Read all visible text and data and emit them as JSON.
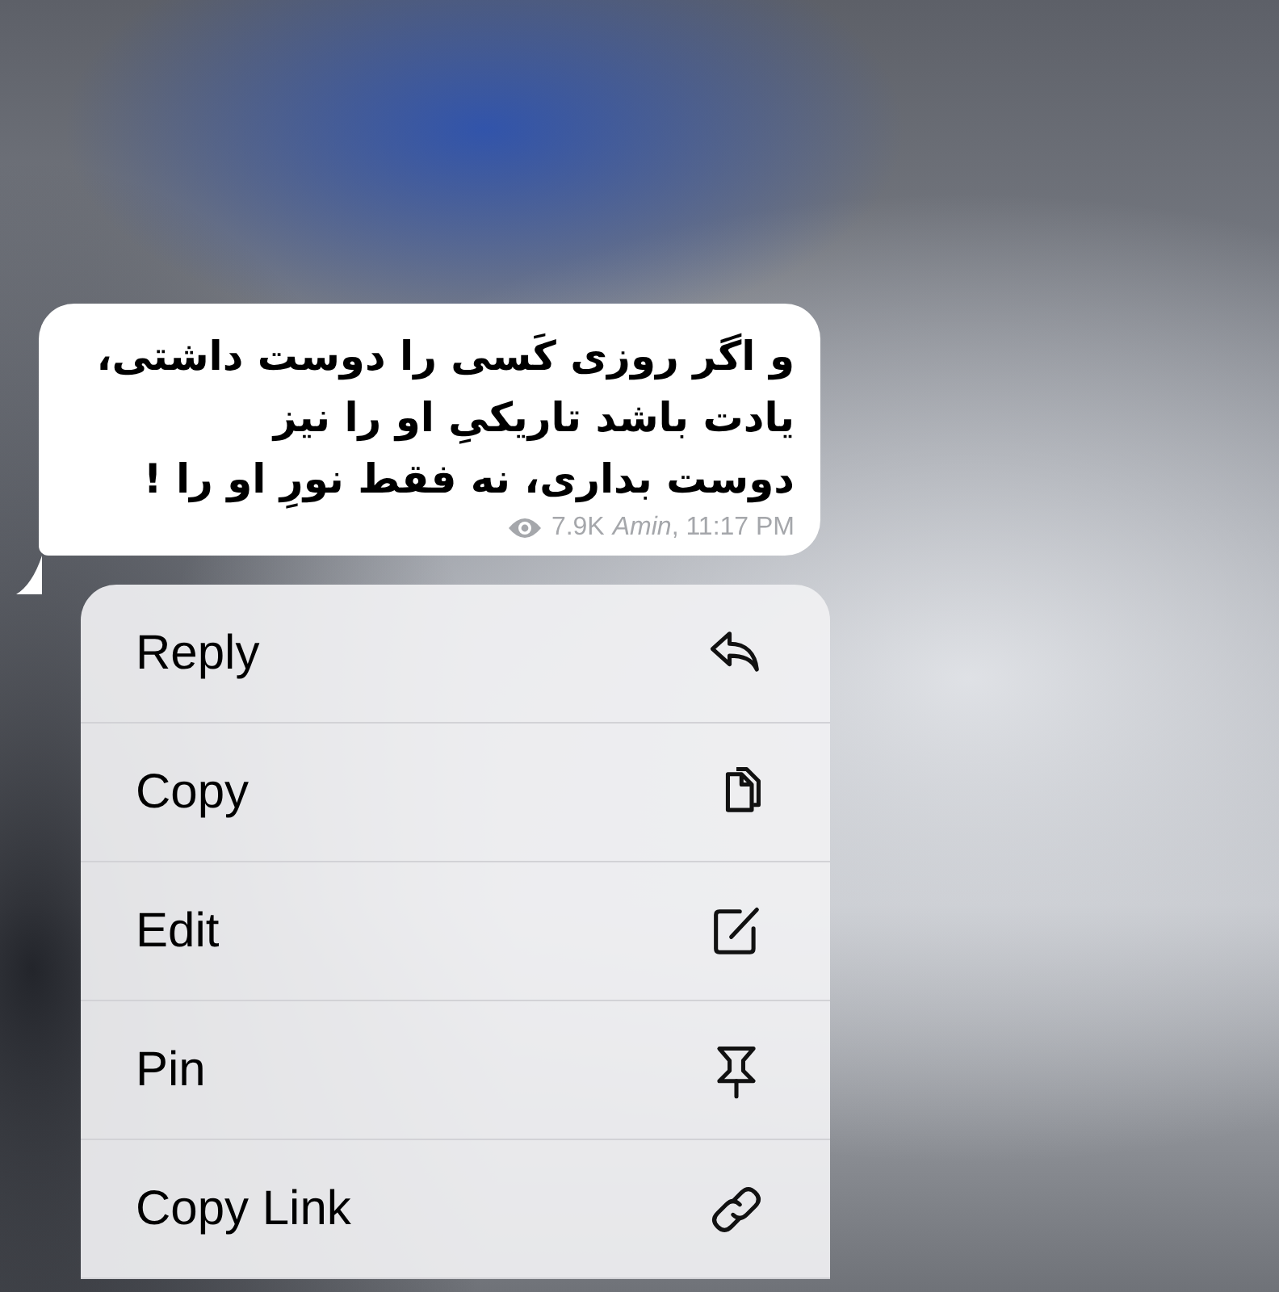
{
  "message": {
    "text": "و اگر روزی کَسی را دوست داشتی،\nیادت باشد تاریکیِ او را نیز\nدوست بداری، نه فقط نورِ او را !",
    "views": "7.9K",
    "signature": "*Amin*, 11:17 PM"
  },
  "menu": [
    {
      "label": "Reply"
    },
    {
      "label": "Copy"
    },
    {
      "label": "Edit"
    },
    {
      "label": "Pin"
    },
    {
      "label": "Copy Link"
    }
  ]
}
